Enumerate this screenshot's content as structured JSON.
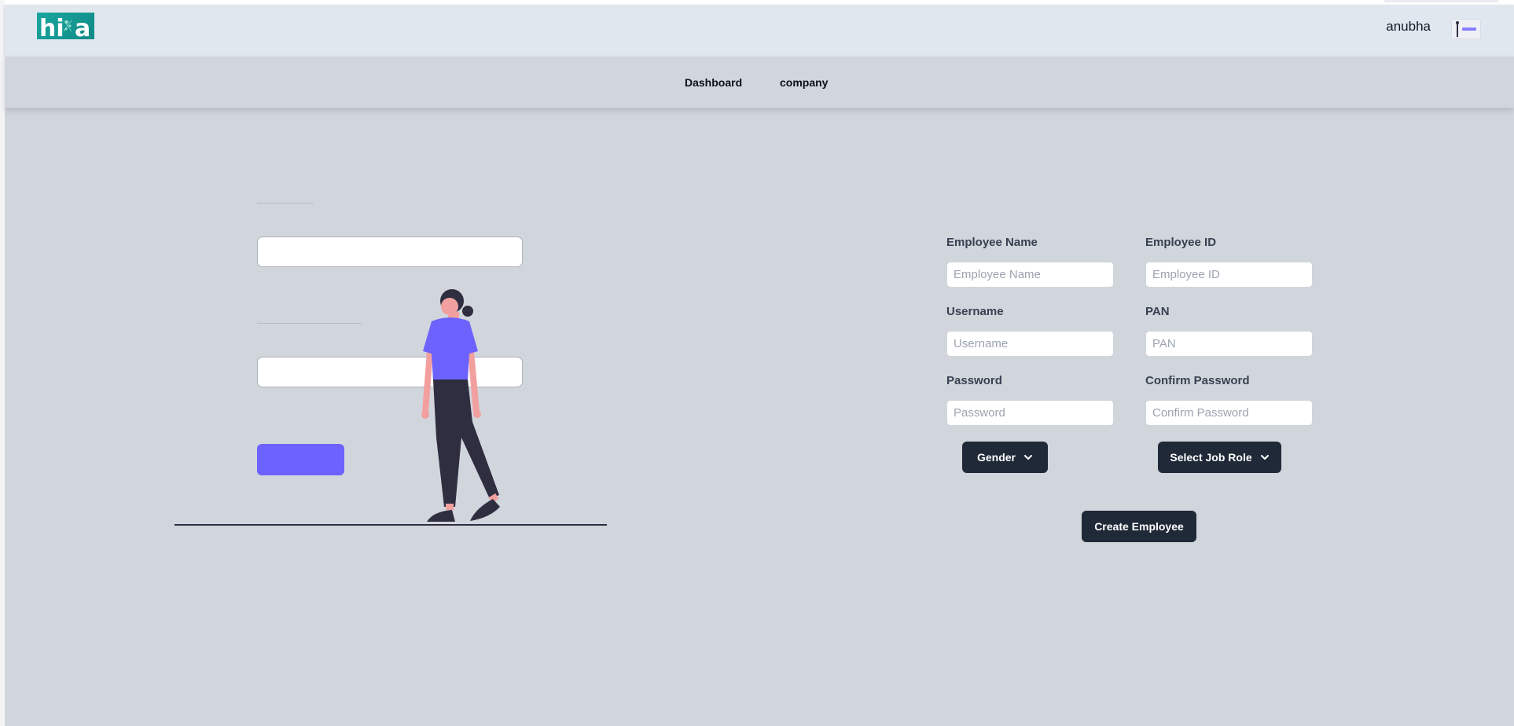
{
  "header": {
    "logo_text": "hi a",
    "username": "anubha"
  },
  "nav": {
    "dashboard": "Dashboard",
    "company": "company"
  },
  "form": {
    "employee_name": {
      "label": "Employee Name",
      "placeholder": "Employee Name"
    },
    "employee_id": {
      "label": "Employee ID",
      "placeholder": "Employee ID"
    },
    "username": {
      "label": "Username",
      "placeholder": "Username"
    },
    "pan": {
      "label": "PAN",
      "placeholder": "PAN"
    },
    "password": {
      "label": "Password",
      "placeholder": "Password"
    },
    "confirm_password": {
      "label": "Confirm Password",
      "placeholder": "Confirm Password"
    },
    "gender_button": "Gender",
    "job_role_button": "Select Job Role",
    "submit_button": "Create Employee"
  },
  "colors": {
    "background": "#d1d5dc",
    "header_bg": "#e1e7ef",
    "accent": "#6c63ff",
    "dark_button": "#1f2937",
    "logo_teal": "#1ba69f"
  },
  "icons": {
    "dropdown": "chevron-down-icon"
  }
}
